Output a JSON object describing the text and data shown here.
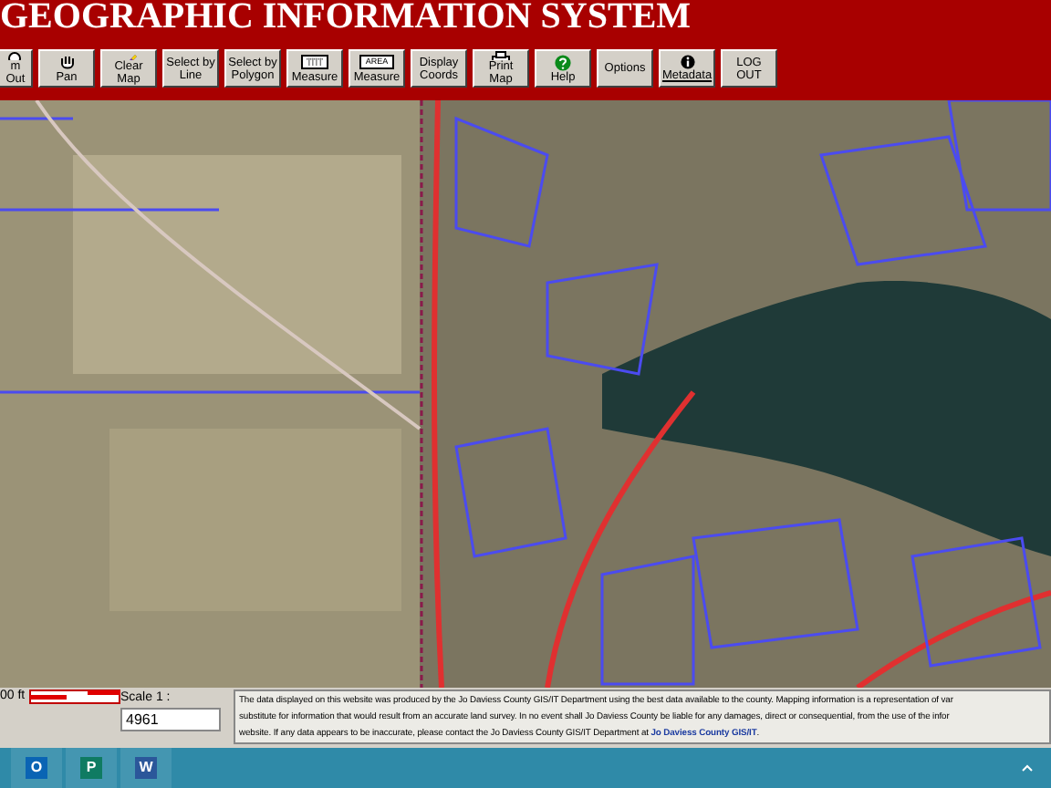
{
  "header": {
    "title": "GEOGRAPHIC INFORMATION SYSTEM"
  },
  "toolbar": [
    {
      "label": "m Out",
      "kind": "zoom"
    },
    {
      "label": "Pan",
      "kind": "hand"
    },
    {
      "label": "Clear Map",
      "kind": "eraser"
    },
    {
      "label": "Select by Line",
      "kind": "plain"
    },
    {
      "label": "Select by Polygon",
      "kind": "plain"
    },
    {
      "label": "Measure",
      "kind": "caption",
      "caption": "'|'|'|'|'"
    },
    {
      "label": "Measure",
      "kind": "caption",
      "caption": "AREA"
    },
    {
      "label": "Display Coords",
      "kind": "plain"
    },
    {
      "label": "Print Map",
      "kind": "printer"
    },
    {
      "label": "Help",
      "kind": "help"
    },
    {
      "label": "Options",
      "kind": "plain"
    },
    {
      "label": "Metadata",
      "kind": "info"
    },
    {
      "label": "LOG OUT",
      "kind": "plain"
    }
  ],
  "footer": {
    "scale_bar_label": "00 ft",
    "scale_label": "Scale 1 :",
    "scale_value": "4961",
    "disclaimer": [
      "The data displayed on this website was produced by the Jo Daviess County GIS/IT Department using the best data available to the county. Mapping information is a representation of var",
      "substitute for information that would result from an accurate land survey. In no event shall Jo Daviess County be liable for any damages, direct or consequential, from the use of the infor",
      "website. If any data appears to be inaccurate, please contact the Jo Daviess County GIS/IT Department at **Jo Daviess County GIS/IT**."
    ]
  },
  "taskbar": [
    {
      "letter": "O",
      "color": "#0a64b4",
      "selected": false
    },
    {
      "letter": "P",
      "color": "#0f7b62",
      "selected": false
    },
    {
      "letter": "W",
      "color": "#2b579a",
      "selected": false
    }
  ]
}
